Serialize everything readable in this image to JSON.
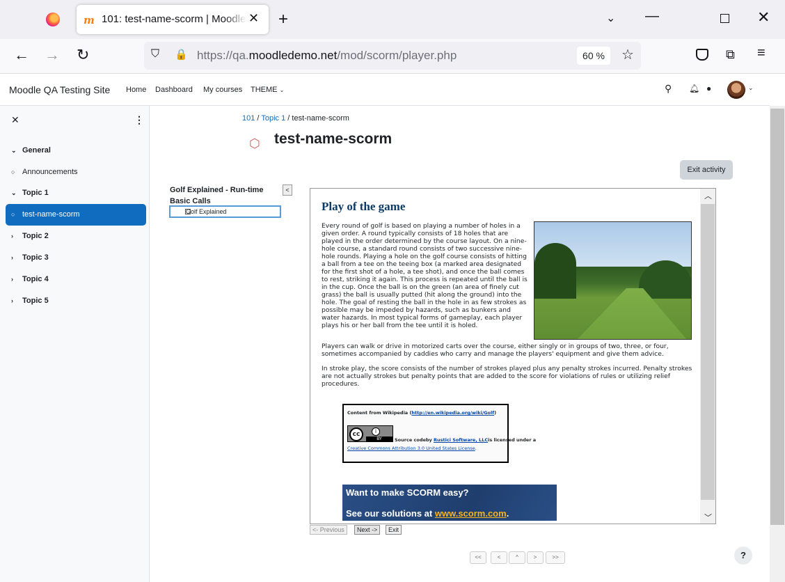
{
  "browser": {
    "tab_title": "101: test-name-scorm | Moodle",
    "url_prefix": "https://qa.",
    "url_domain": "moodledemo.net",
    "url_path": "/mod/scorm/player.php",
    "zoom": "60 %"
  },
  "header": {
    "site_name": "Moodle QA Testing Site",
    "nav": [
      "Home",
      "Dashboard",
      "My courses",
      "THEME"
    ]
  },
  "drawer": {
    "items": [
      {
        "label": "General",
        "type": "section"
      },
      {
        "label": "Announcements",
        "type": "activity"
      },
      {
        "label": "Topic 1",
        "type": "section"
      },
      {
        "label": "test-name-scorm",
        "type": "activity",
        "active": true
      },
      {
        "label": "Topic 2",
        "type": "section"
      },
      {
        "label": "Topic 3",
        "type": "section"
      },
      {
        "label": "Topic 4",
        "type": "section"
      },
      {
        "label": "Topic 5",
        "type": "section"
      }
    ]
  },
  "breadcrumb": [
    "101",
    "Topic 1",
    "test-name-scorm"
  ],
  "page_title": "test-name-scorm",
  "exit_activity": "Exit activity",
  "toc": {
    "title": "Golf Explained - Run-time Basic Calls",
    "item": "Golf Explained"
  },
  "sco": {
    "heading": "Play of the game",
    "p1": "Every round of golf is based on playing a number of holes in a given order. A round typically consists of 18 holes that are played in the order determined by the course layout. On a nine-hole course, a standard round consists of two successive nine-hole rounds. Playing a hole on the golf course consists of hitting a ball from a tee on the teeing box (a marked area designated for the first shot of a hole, a tee shot), and once the ball comes to rest, striking it again. This process is repeated until the ball is in the cup. Once the ball is on the green (an area of finely cut grass) the ball is usually putted (hit along the ground) into the hole. The goal of resting the ball in the hole in as few strokes as possible may be impeded by hazards, such as bunkers and water hazards. In most typical forms of gameplay, each player plays his or her ball from the tee until it is holed.",
    "p2": "Players can walk or drive in motorized carts over the course, either singly or in groups of two, three, or four, sometimes accompanied by caddies who carry and manage the players' equipment and give them advice.",
    "p3": "In stroke play, the score consists of the number of strokes played plus any penalty strokes incurred. Penalty strokes are not actually strokes but penalty points that are added to the score for violations of rules or utilizing relief procedures.",
    "license": {
      "line1_prefix": "Content from Wikipedia (",
      "line1_link": "http://en.wikipedia.org/wiki/Golf",
      "line1_suffix": ")",
      "line2_prefix": "Source codeby ",
      "line2_link": "Rustici Software, LLC",
      "line2_suffix": "is licensed under a",
      "line3_link": "Creative Commons Attribution 3.0 United States License",
      "line3_suffix": "."
    },
    "banner_line1": "Want to make SCORM easy?",
    "banner_line2_prefix": "See our solutions at ",
    "banner_link": "www.scorm.com",
    "banner_suffix": "."
  },
  "sco_nav": {
    "prev": "<- Previous",
    "next": "Next ->",
    "exit": "Exit"
  },
  "page_nav": [
    "<<",
    "<",
    "^",
    ">",
    ">>"
  ],
  "help": "?",
  "colors": {
    "accent": "#0f6cbf",
    "banner": "#2a4f86"
  }
}
